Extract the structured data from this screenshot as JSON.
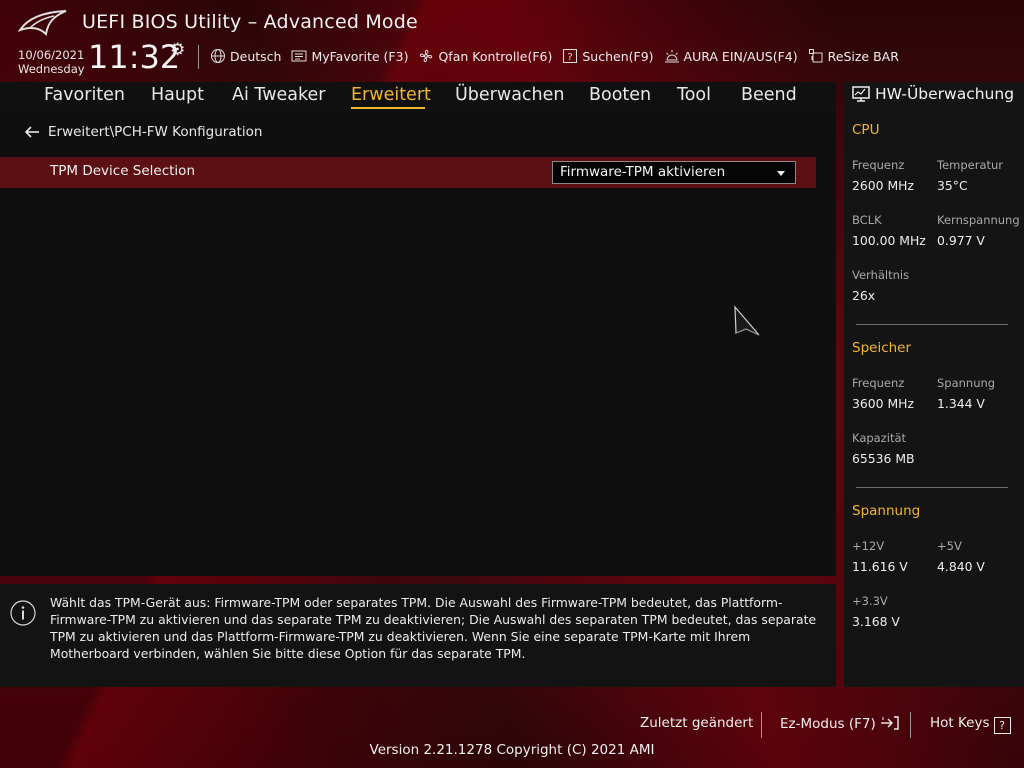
{
  "header": {
    "title": "UEFI BIOS Utility – Advanced Mode",
    "date": "10/06/2021",
    "day": "Wednesday",
    "time": "11:32"
  },
  "toolbar": {
    "items": [
      {
        "label": "Deutsch",
        "icon": "globe-icon"
      },
      {
        "label": "MyFavorite (F3)",
        "icon": "favorite-list-icon"
      },
      {
        "label": "Qfan Kontrolle(F6)",
        "icon": "fan-icon"
      },
      {
        "label": "Suchen(F9)",
        "icon": "search-question-icon"
      },
      {
        "label": "AURA EIN/AUS(F4)",
        "icon": "aura-light-icon"
      },
      {
        "label": "ReSize BAR",
        "icon": "resize-bar-icon"
      }
    ]
  },
  "nav": {
    "tabs": [
      "Favoriten",
      "Haupt",
      "Ai Tweaker",
      "Erweitert",
      "Überwachen",
      "Booten",
      "Tool",
      "Beend"
    ],
    "active": "Erweitert"
  },
  "main": {
    "breadcrumb": "Erweitert\\PCH-FW Konfiguration",
    "setting_label": "TPM Device Selection",
    "setting_value": "Firmware-TPM aktivieren"
  },
  "help": {
    "text": "Wählt das TPM-Gerät aus: Firmware-TPM oder separates TPM. Die Auswahl des Firmware-TPM bedeutet, das Plattform-Firmware-TPM zu aktivieren und das separate TPM zu deaktivieren; Die Auswahl des separaten TPM bedeutet, das separate TPM zu aktivieren und das Plattform-Firmware-TPM zu deaktivieren. Wenn Sie eine separate TPM-Karte mit Ihrem Motherboard verbinden, wählen Sie bitte diese Option für das separate TPM."
  },
  "hw": {
    "title": "HW-Überwachung",
    "cpu": {
      "title": "CPU",
      "freq_label": "Frequenz",
      "freq": "2600 MHz",
      "temp_label": "Temperatur",
      "temp": "35°C",
      "bclk_label": "BCLK",
      "bclk": "100.00 MHz",
      "vcore_label": "Kernspannung",
      "vcore": "0.977 V",
      "ratio_label": "Verhältnis",
      "ratio": "26x"
    },
    "memory": {
      "title": "Speicher",
      "freq_label": "Frequenz",
      "freq": "3600 MHz",
      "volt_label": "Spannung",
      "volt": "1.344 V",
      "cap_label": "Kapazität",
      "cap": "65536 MB"
    },
    "voltage": {
      "title": "Spannung",
      "v12_label": "+12V",
      "v12": "11.616 V",
      "v5_label": "+5V",
      "v5": "4.840 V",
      "v33_label": "+3.3V",
      "v33": "3.168 V"
    }
  },
  "footer": {
    "last_changed": "Zuletzt geändert",
    "ez_mode": "Ez-Modus (F7)",
    "hot_keys": "Hot Keys",
    "hot_keys_glyph": "?",
    "version": "Version 2.21.1278 Copyright (C) 2021 AMI"
  },
  "colors": {
    "accent": "#f2b530",
    "highlight_row": "#5c1014",
    "panel_bg": "#141414"
  }
}
